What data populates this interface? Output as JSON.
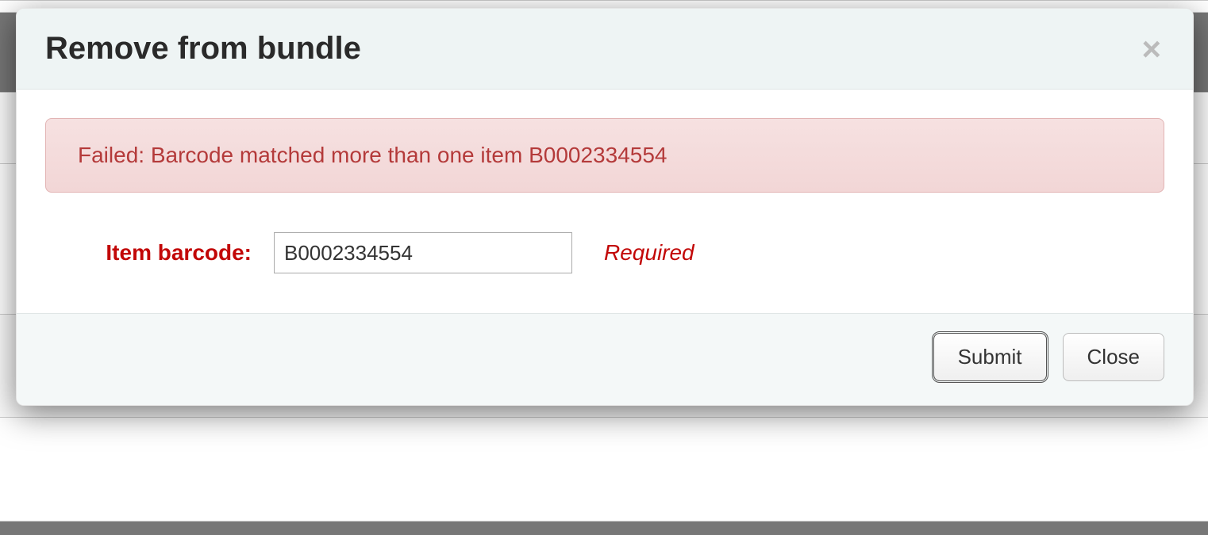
{
  "modal": {
    "title": "Remove from bundle",
    "close_icon_title": "Close"
  },
  "alert": {
    "message": "Failed: Barcode matched more than one item B0002334554"
  },
  "form": {
    "barcode_label": "Item barcode:",
    "barcode_value": "B0002334554",
    "required_hint": "Required"
  },
  "footer": {
    "submit_label": "Submit",
    "close_label": "Close"
  }
}
